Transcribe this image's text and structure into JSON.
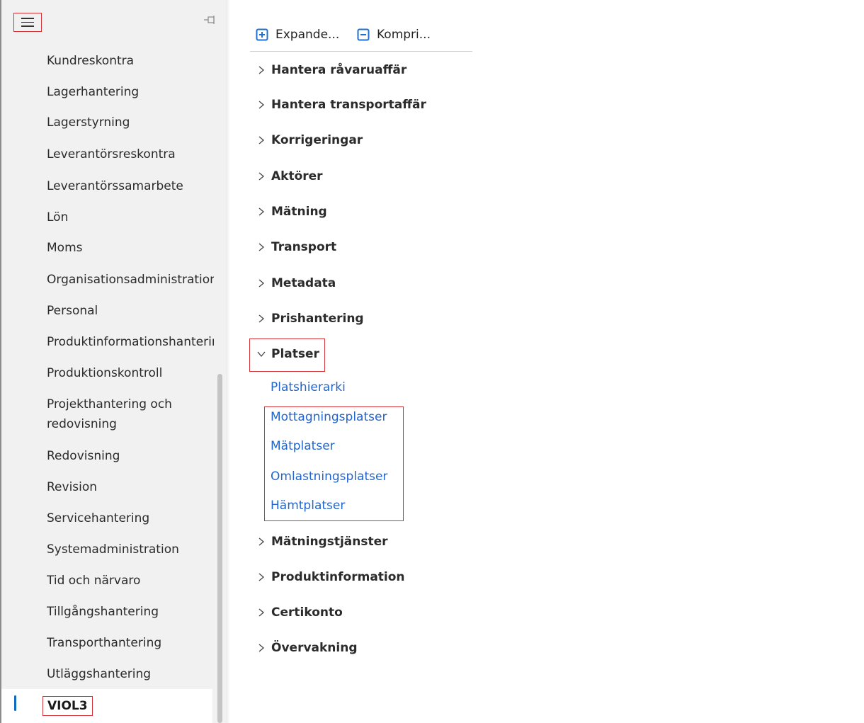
{
  "nav": {
    "items": [
      {
        "label": "Kundreskontra"
      },
      {
        "label": "Lagerhantering"
      },
      {
        "label": "Lagerstyrning"
      },
      {
        "label": "Leverantörsreskontra"
      },
      {
        "label": "Leverantörssamarbete"
      },
      {
        "label": "Lön"
      },
      {
        "label": "Moms"
      },
      {
        "label": "Organisationsadministration"
      },
      {
        "label": "Personal"
      },
      {
        "label": "Produktinformationshantering"
      },
      {
        "label": "Produktionskontroll"
      },
      {
        "label": "Projekthantering och redovisning"
      },
      {
        "label": "Redovisning"
      },
      {
        "label": "Revision"
      },
      {
        "label": "Servicehantering"
      },
      {
        "label": "Systemadministration"
      },
      {
        "label": "Tid och närvaro"
      },
      {
        "label": "Tillgångshantering"
      },
      {
        "label": "Transporthantering"
      },
      {
        "label": "Utläggshantering"
      }
    ],
    "selected": {
      "label": "VIOL3"
    }
  },
  "toolbar": {
    "expand_label": "Expande...",
    "collapse_label": "Kompri..."
  },
  "tree": {
    "groups_before": [
      {
        "label": "Hantera råvaruaffär"
      },
      {
        "label": "Hantera transportaffär"
      },
      {
        "label": "Korrigeringar"
      },
      {
        "label": "Aktörer"
      },
      {
        "label": "Mätning"
      },
      {
        "label": "Transport"
      },
      {
        "label": "Metadata"
      },
      {
        "label": "Prishantering"
      }
    ],
    "expanded_group": {
      "label": "Platser",
      "links": [
        {
          "label": "Platshierarki"
        },
        {
          "label": "Mottagningsplatser"
        },
        {
          "label": "Mätplatser"
        },
        {
          "label": "Omlastningsplatser"
        },
        {
          "label": "Hämtplatser"
        }
      ]
    },
    "groups_after": [
      {
        "label": "Mätningstjänster"
      },
      {
        "label": "Produktinformation"
      },
      {
        "label": "Certikonto"
      },
      {
        "label": "Övervakning"
      }
    ]
  },
  "colors": {
    "accent": "#0f6cbd",
    "link": "#2266cc",
    "highlight_box": "#d13438",
    "nav_background": "#f1f1f1"
  }
}
